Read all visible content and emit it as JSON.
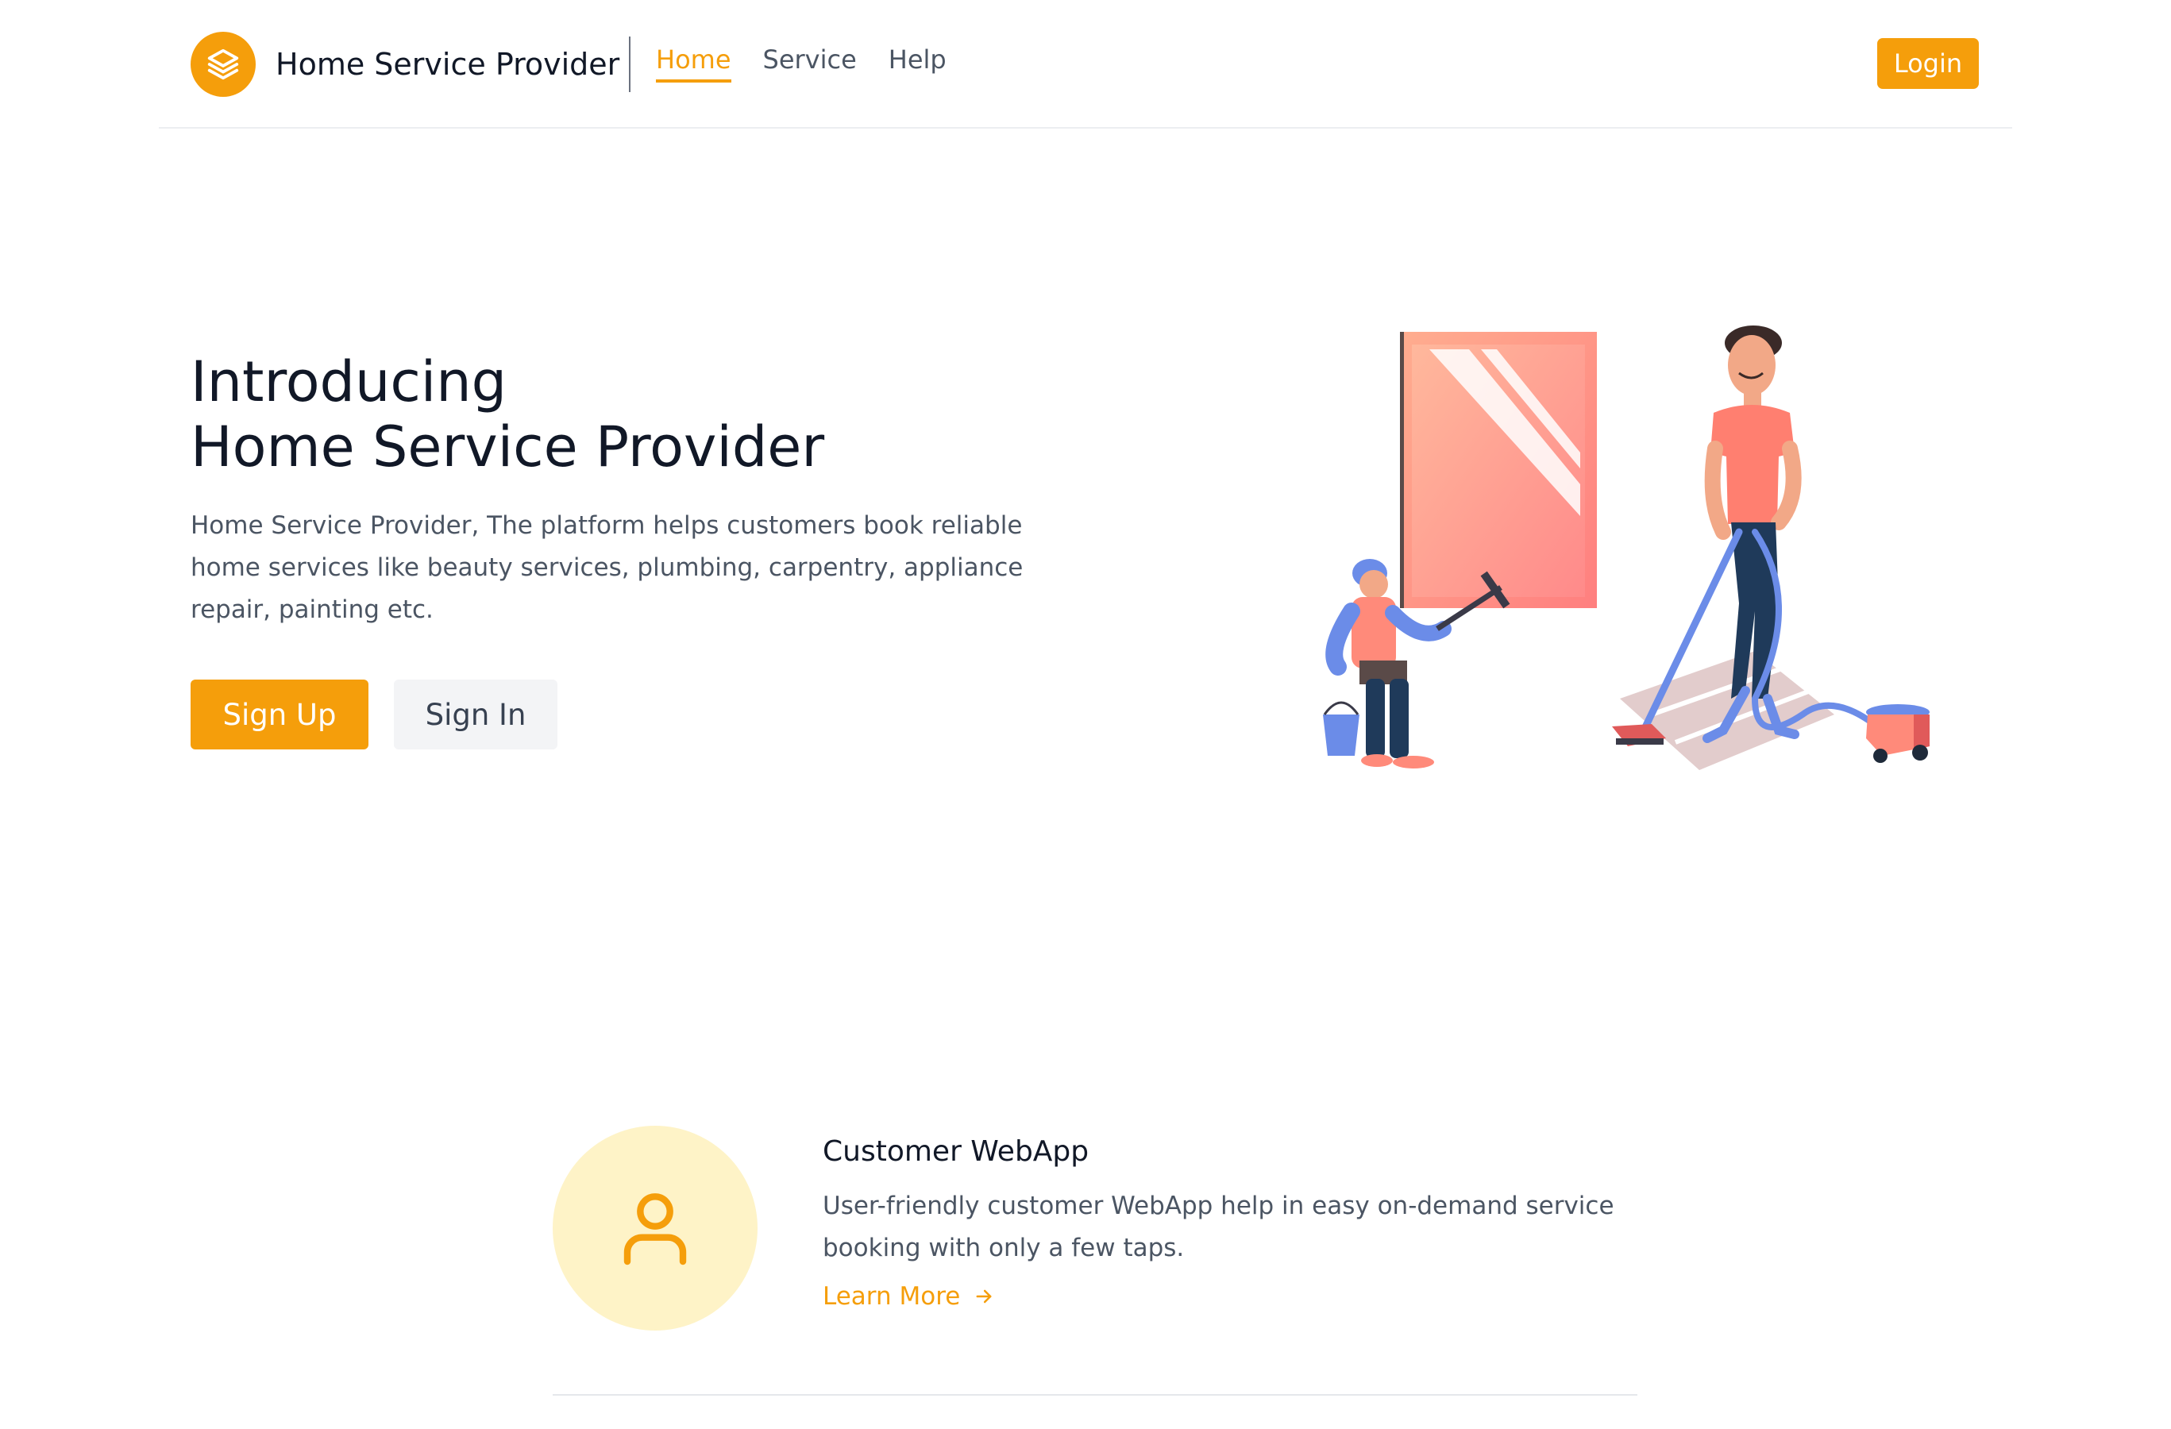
{
  "header": {
    "brand_name": "Home Service Provider",
    "logo_icon": "stack-layers-icon",
    "nav": [
      {
        "label": "Home",
        "active": true
      },
      {
        "label": "Service",
        "active": false
      },
      {
        "label": "Help",
        "active": false
      }
    ],
    "login_label": "Login"
  },
  "hero": {
    "title_line1": "Introducing",
    "title_line2": "Home Service Provider",
    "description": "Home Service Provider, The platform helps customers book reliable home services like beauty services, plumbing, carpentry, appliance repair, painting etc.",
    "signup_label": "Sign Up",
    "signin_label": "Sign In",
    "illustration": "home-cleaning-illustration"
  },
  "feature": {
    "icon": "user-icon",
    "title": "Customer WebApp",
    "description": "User-friendly customer WebApp help in easy on-demand service booking with only a few taps.",
    "link_label": "Learn More",
    "link_icon": "arrow-right-icon"
  },
  "colors": {
    "accent": "#f59e0b",
    "accent_light": "#fef3c7",
    "text_dark": "#111827",
    "text_muted": "#4b5563"
  }
}
